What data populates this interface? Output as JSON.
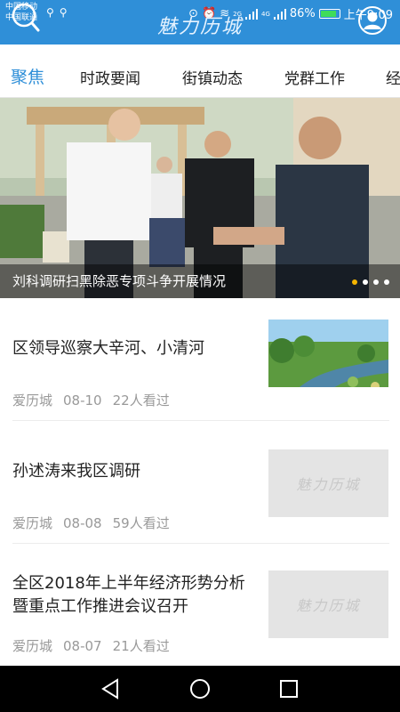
{
  "status": {
    "carrier1": "中国移动",
    "carrier2": "中国联通",
    "net1": "2G",
    "net2": "4G",
    "battery": "86%",
    "time": "上午9:09"
  },
  "app": {
    "logo": "魅力历城"
  },
  "tabs": [
    {
      "label": "聚焦",
      "active": true
    },
    {
      "label": "时政要闻",
      "active": false
    },
    {
      "label": "街镇动态",
      "active": false
    },
    {
      "label": "党群工作",
      "active": false
    },
    {
      "label": "经",
      "active": false
    }
  ],
  "banner": {
    "caption": "刘科调研扫黑除恶专项斗争开展情况",
    "slide_count": 4,
    "active_slide": 1
  },
  "news": [
    {
      "title": "区领导巡察大辛河、小清河",
      "source": "爱历城",
      "date": "08-10",
      "views": "22人看过",
      "thumb": "river-photo"
    },
    {
      "title": "孙述涛来我区调研",
      "source": "爱历城",
      "date": "08-08",
      "views": "59人看过",
      "thumb": "placeholder",
      "thumb_text": "魅力历城"
    },
    {
      "title": "全区2018年上半年经济形势分析暨重点工作推进会议召开",
      "source": "爱历城",
      "date": "08-07",
      "views": "21人看过",
      "thumb": "placeholder",
      "thumb_text": "魅力历城"
    }
  ],
  "colors": {
    "brand": "#2f8fd8",
    "active_dot": "#f4b400"
  },
  "icons": {
    "search": "search-icon",
    "user": "user-icon",
    "back": "back-triangle-icon",
    "home": "home-circle-icon",
    "recents": "recents-square-icon"
  }
}
